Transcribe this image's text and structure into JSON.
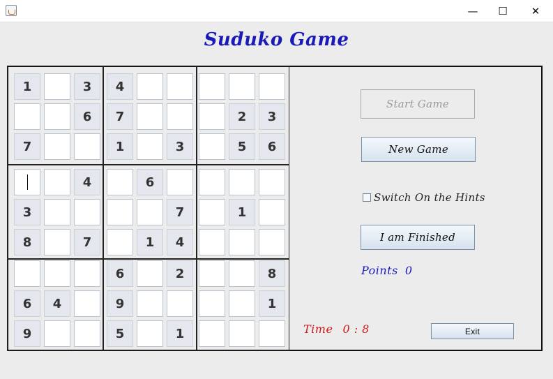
{
  "window": {
    "min_symbol": "—",
    "max_symbol": "☐",
    "close_symbol": "✕"
  },
  "title": "Suduko Game",
  "board": {
    "cells": [
      [
        "1",
        "",
        "3",
        "4",
        "",
        "",
        "",
        "",
        ""
      ],
      [
        "",
        "",
        "6",
        "7",
        "",
        "",
        "",
        "2",
        "3"
      ],
      [
        "7",
        "",
        "",
        "1",
        "",
        "3",
        "",
        "5",
        "6"
      ],
      [
        "",
        "",
        "4",
        "",
        "6",
        "",
        "",
        "",
        ""
      ],
      [
        "3",
        "",
        "",
        "",
        "",
        "7",
        "",
        "1",
        ""
      ],
      [
        "8",
        "",
        "7",
        "",
        "1",
        "4",
        "",
        "",
        ""
      ],
      [
        "",
        "",
        "",
        "6",
        "",
        "2",
        "",
        "",
        "8"
      ],
      [
        "6",
        "4",
        "",
        "9",
        "",
        "",
        "",
        "",
        "1"
      ],
      [
        "9",
        "",
        "",
        "5",
        "",
        "1",
        "",
        "",
        ""
      ]
    ],
    "given": [
      [
        1,
        0,
        1,
        1,
        0,
        0,
        0,
        0,
        0
      ],
      [
        0,
        0,
        1,
        1,
        0,
        0,
        0,
        1,
        1
      ],
      [
        1,
        0,
        0,
        1,
        0,
        1,
        0,
        1,
        1
      ],
      [
        0,
        0,
        1,
        0,
        1,
        0,
        0,
        0,
        0
      ],
      [
        1,
        0,
        0,
        0,
        0,
        1,
        0,
        1,
        0
      ],
      [
        1,
        0,
        1,
        0,
        1,
        1,
        0,
        0,
        0
      ],
      [
        0,
        0,
        0,
        1,
        0,
        1,
        0,
        0,
        1
      ],
      [
        1,
        1,
        0,
        1,
        0,
        0,
        0,
        0,
        1
      ],
      [
        1,
        0,
        0,
        1,
        0,
        1,
        0,
        0,
        0
      ]
    ],
    "focused": [
      3,
      0
    ]
  },
  "buttons": {
    "start": "Start Game",
    "new_game": "New Game",
    "finished": "I am Finished",
    "exit": "Exit"
  },
  "hints": {
    "label": "Switch On the Hints",
    "checked": false
  },
  "points": {
    "label": "Points",
    "value": "0"
  },
  "timer": {
    "label": "Time",
    "value": "0 : 8"
  },
  "colors": {
    "title": "#1a1ab8",
    "points": "#1a1ab8",
    "timer": "#d01818"
  }
}
